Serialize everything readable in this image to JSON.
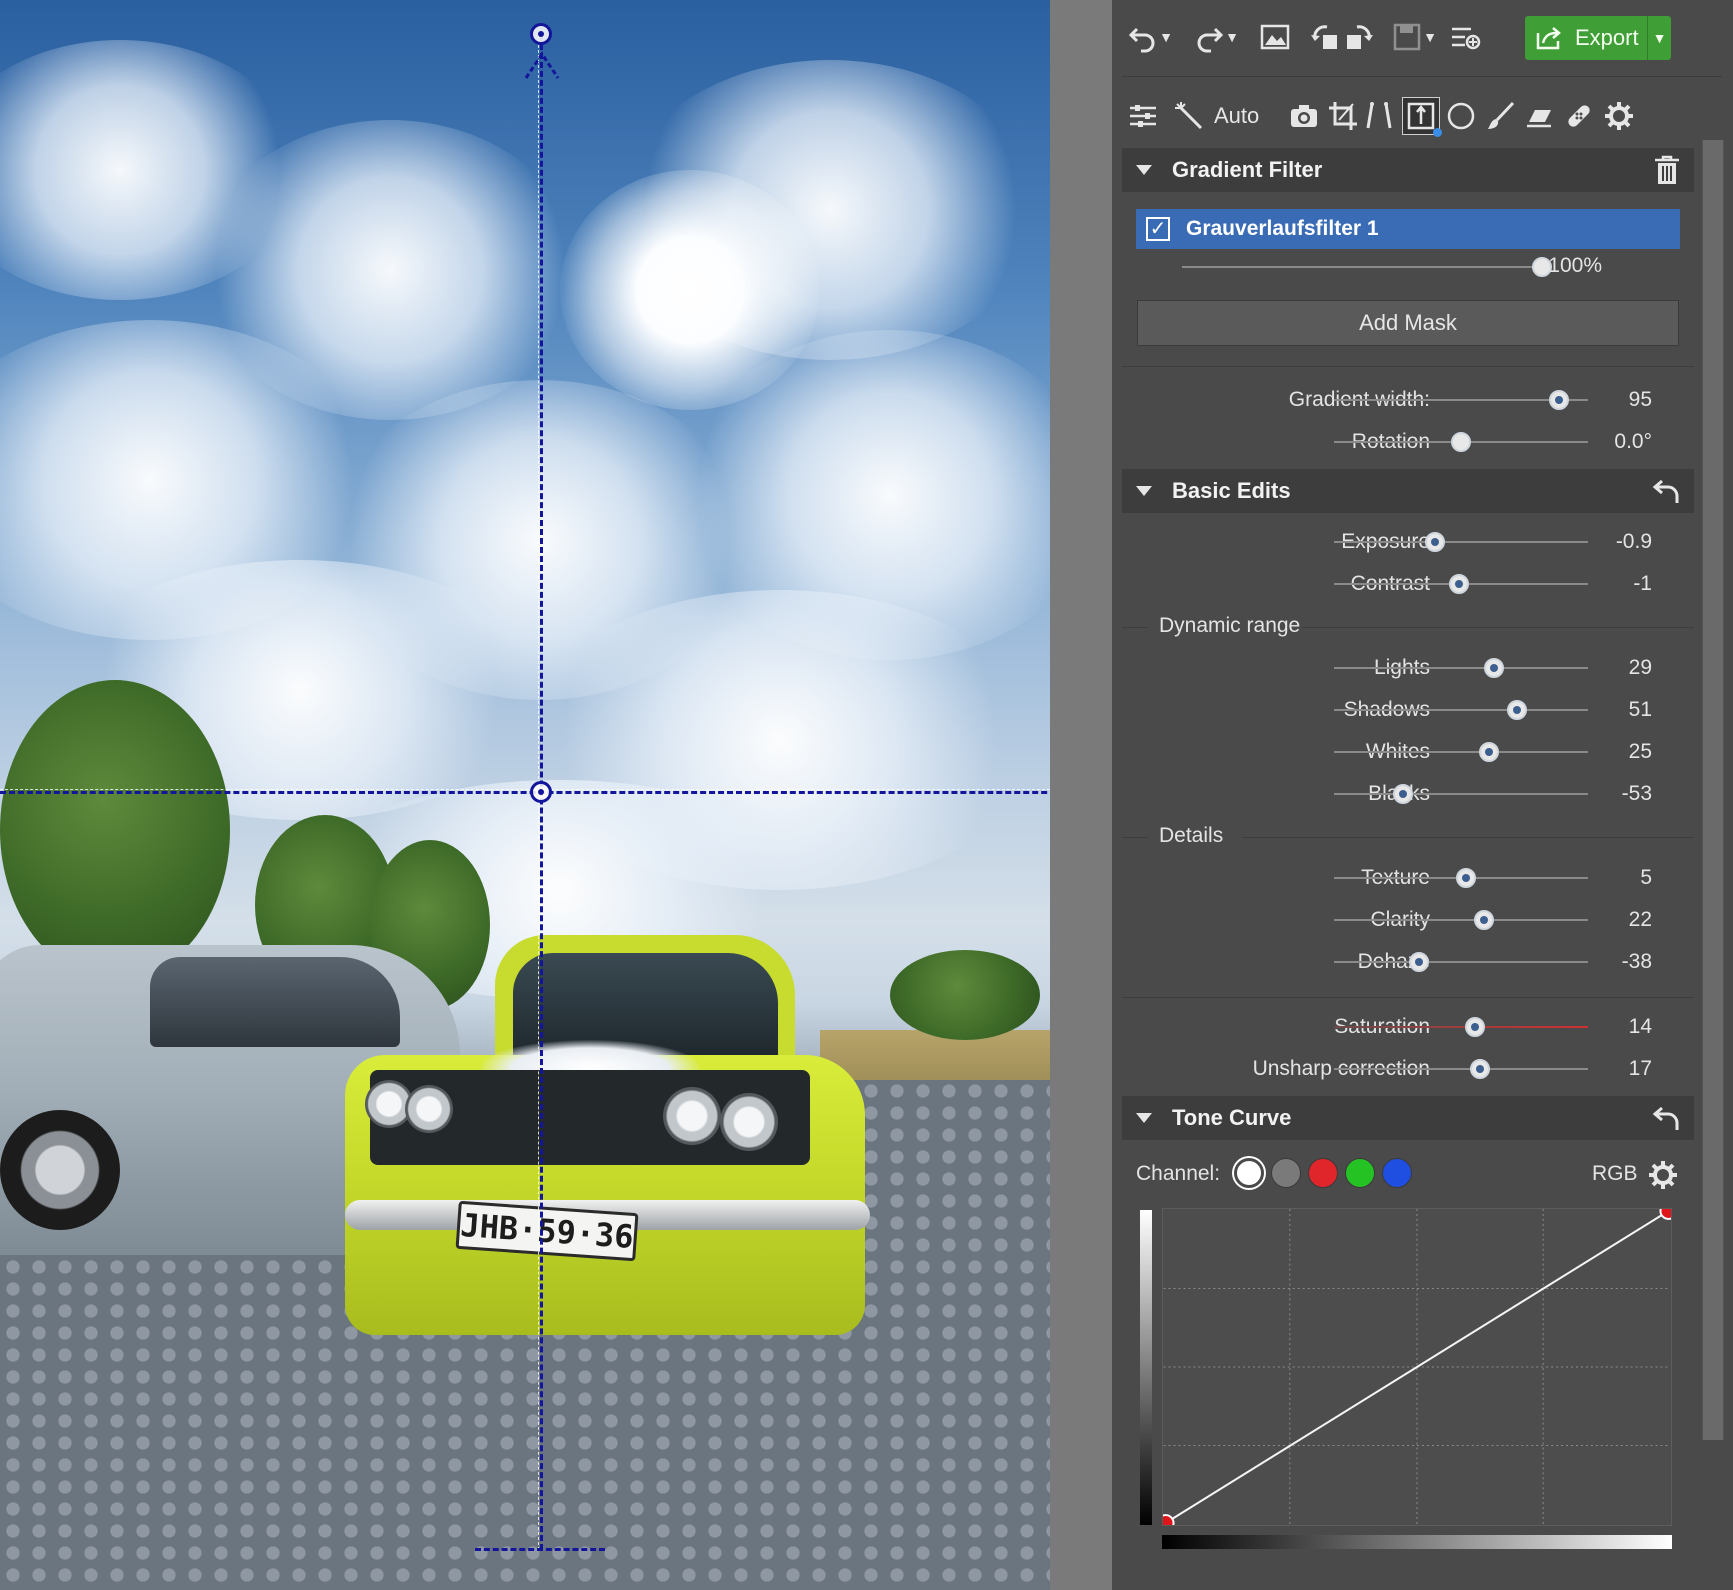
{
  "toolbar": {
    "export_label": "Export",
    "auto_label": "Auto"
  },
  "gradient_filter": {
    "section_title": "Gradient Filter",
    "filter_name": "Grauverlaufsfilter 1",
    "checked": true,
    "opacity_value": "100%",
    "opacity_fraction": 1.0,
    "add_mask_label": "Add Mask",
    "width_label": "Gradient width:",
    "width_value": "95",
    "width_fraction": 0.92,
    "rotation_label": "Rotation",
    "rotation_value": "0.0°",
    "rotation_fraction": 0.5
  },
  "basic_edits": {
    "section_title": "Basic Edits",
    "sliders": [
      {
        "label": "Exposure",
        "value": "-0.9",
        "fraction": 0.39
      },
      {
        "label": "Contrast",
        "value": "-1",
        "fraction": 0.49
      }
    ],
    "dynamic_range_title": "Dynamic range",
    "dynamic_range": [
      {
        "label": "Lights",
        "value": "29",
        "fraction": 0.64
      },
      {
        "label": "Shadows",
        "value": "51",
        "fraction": 0.74
      },
      {
        "label": "Whites",
        "value": "25",
        "fraction": 0.62
      },
      {
        "label": "Blacks",
        "value": "-53",
        "fraction": 0.25
      }
    ],
    "details_title": "Details",
    "details": [
      {
        "label": "Texture",
        "value": "5",
        "fraction": 0.52
      },
      {
        "label": "Clarity",
        "value": "22",
        "fraction": 0.6
      },
      {
        "label": "Dehaze",
        "value": "-38",
        "fraction": 0.32
      }
    ],
    "extra": [
      {
        "label": "Saturation",
        "value": "14",
        "fraction": 0.56
      },
      {
        "label": "Unsharp correction",
        "value": "17",
        "fraction": 0.58
      }
    ]
  },
  "tone_curve": {
    "section_title": "Tone Curve",
    "channel_label": "Channel:",
    "mode_label": "RGB",
    "channels": [
      "#ffffff",
      "#7a7a7a",
      "#e0262a",
      "#25c224",
      "#1f4fe0"
    ]
  },
  "photo": {
    "plate_text": "JHB·59·36"
  },
  "colors": {
    "accent": "#3a6bb5",
    "export_green": "#3f9e35",
    "guide_blue": "#13159a",
    "curve_point": "#e0141b"
  }
}
